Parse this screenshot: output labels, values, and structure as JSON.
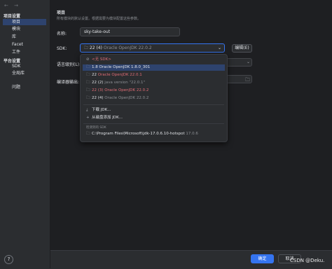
{
  "sidebar": {
    "nav": "← →",
    "project_settings": "项目设置",
    "items": [
      {
        "label": "项目",
        "selected": true
      },
      {
        "label": "模块"
      },
      {
        "label": "库"
      },
      {
        "label": "Facet"
      },
      {
        "label": "工件"
      }
    ],
    "platform_settings": "平台设置",
    "platform_items": [
      {
        "label": "SDK"
      },
      {
        "label": "全局库"
      }
    ],
    "problems": "问题",
    "help": "?"
  },
  "main": {
    "title": "项目",
    "description": "所有模块的默认设置。根据需要为模块配置这些参数。",
    "name_label": "名称:",
    "name_value": "sky-take-out",
    "sdk_label": "SDK:",
    "sdk_value_main": "22 (4)",
    "sdk_value_sub": "Oracle OpenJDK 22.0.2",
    "edit_button": "编辑(E)",
    "lang_label": "语言级别(L):",
    "compiler_label": "编译器输出:"
  },
  "sdk_popup": {
    "items": [
      {
        "icon": "none-sdk-icon",
        "main": "<无 SDK>",
        "sub": "",
        "red": true
      },
      {
        "icon": "folder-icon",
        "main": "1.8",
        "sub": "Oracle OpenJDK 1.8.0_301",
        "selected": true
      },
      {
        "icon": "folder-icon",
        "main": "22",
        "sub": "Oracle OpenJDK 22.0.1",
        "red": true
      },
      {
        "icon": "folder-icon",
        "main": "22 (2)",
        "sub": "java version \"22.0.1\""
      },
      {
        "icon": "folder-icon",
        "main": "22 (3)",
        "sub": "Oracle OpenJDK 22.0.2",
        "red": true
      },
      {
        "icon": "folder-icon",
        "main": "22 (4)",
        "sub": "Oracle OpenJDK 22.0.2"
      }
    ],
    "actions": [
      {
        "icon": "download-icon",
        "label": "下载 JDK..."
      },
      {
        "icon": "add-icon",
        "label": "从磁盘添加 JDK..."
      }
    ],
    "detected_title": "检测到的 SDK",
    "detected": [
      {
        "icon": "folder-icon",
        "main": "C:\\Program Files\\Microsoft\\jdk-17.0.6.10-hotspot",
        "sub": "17.0.6"
      }
    ]
  },
  "footer": {
    "ok": "确定",
    "cancel": "取消"
  },
  "watermark": "CSDN @Deku."
}
